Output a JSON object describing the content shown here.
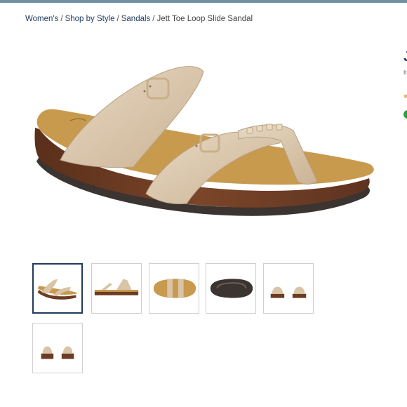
{
  "breadcrumb": {
    "items": [
      "Women's",
      "Shop by Style",
      "Sandals"
    ],
    "separator": "/",
    "current": "Jett Toe Loop Slide Sandal"
  },
  "product": {
    "title_initial": "J",
    "subtitle_initial": "It"
  },
  "gallery": {
    "main_image": "sandal-side-view",
    "thumbnails": [
      {
        "view": "angled-side",
        "selected": true
      },
      {
        "view": "side-profile",
        "selected": false
      },
      {
        "view": "top-down",
        "selected": false
      },
      {
        "view": "outsole-bottom",
        "selected": false
      },
      {
        "view": "front-pair",
        "selected": false
      },
      {
        "view": "back-pair",
        "selected": false
      }
    ]
  },
  "colors": {
    "link": "#1f3b5c",
    "strap": "#d9c4a8",
    "footbed": "#c89a4e",
    "sole_wood": "#6b3b22",
    "outsole": "#3b3430",
    "stock_indicator": "#2e9e3a",
    "star": "#e2a43a"
  }
}
